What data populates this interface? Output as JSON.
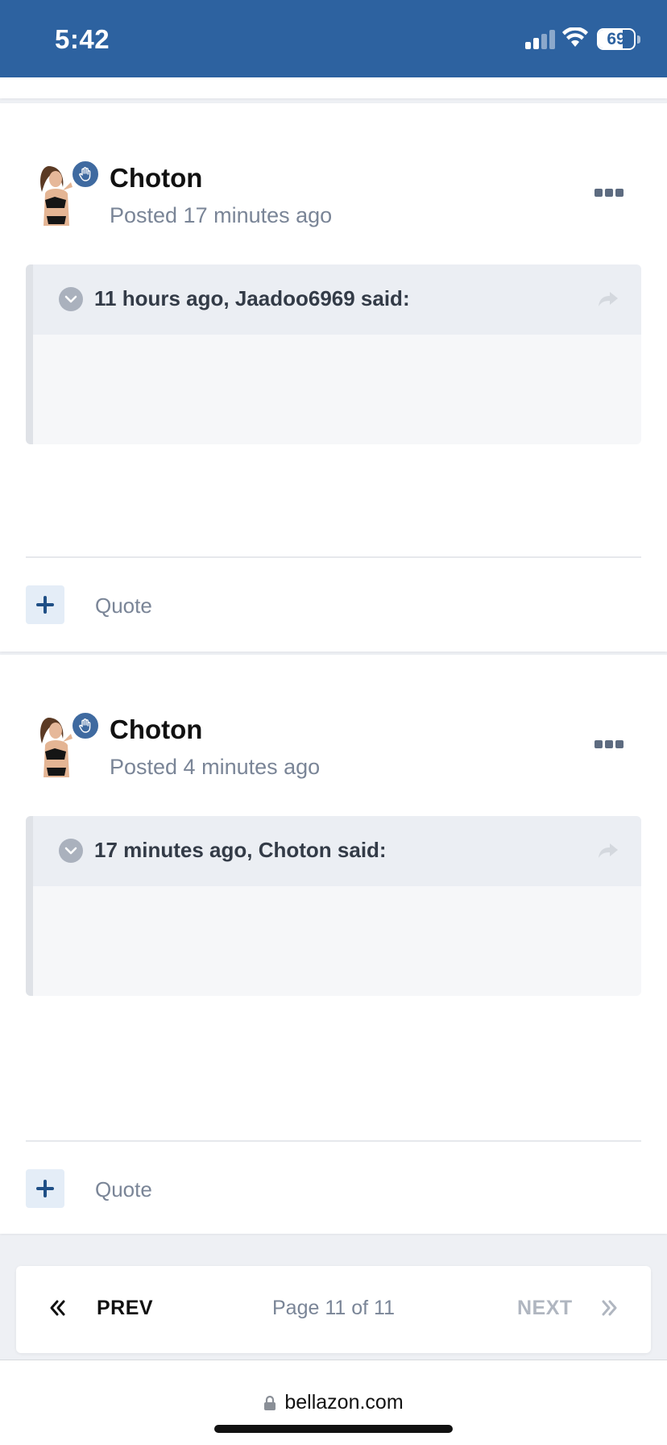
{
  "status_bar": {
    "time": "5:42",
    "battery_level": "69",
    "battery_fraction": 0.69,
    "signal_bars_active": 2,
    "icons": [
      "signal-icon",
      "wifi-icon",
      "battery-icon"
    ]
  },
  "posts": [
    {
      "author": "Choton",
      "posted": "Posted 17 minutes ago",
      "quote_citation": "11 hours ago, Jaadoo6969 said:",
      "quote_label": "Quote"
    },
    {
      "author": "Choton",
      "posted": "Posted 4 minutes ago",
      "quote_citation": "17 minutes ago, Choton said:",
      "quote_label": "Quote"
    }
  ],
  "pagination": {
    "prev_label": "PREV",
    "page_label": "Page 11 of 11",
    "next_label": "NEXT"
  },
  "browser": {
    "url": "bellazon.com"
  },
  "colors": {
    "header": "#2d62a0",
    "badge": "#3f6aa0",
    "muted_text": "#7a8597",
    "disabled_text": "#b0b6c0"
  }
}
